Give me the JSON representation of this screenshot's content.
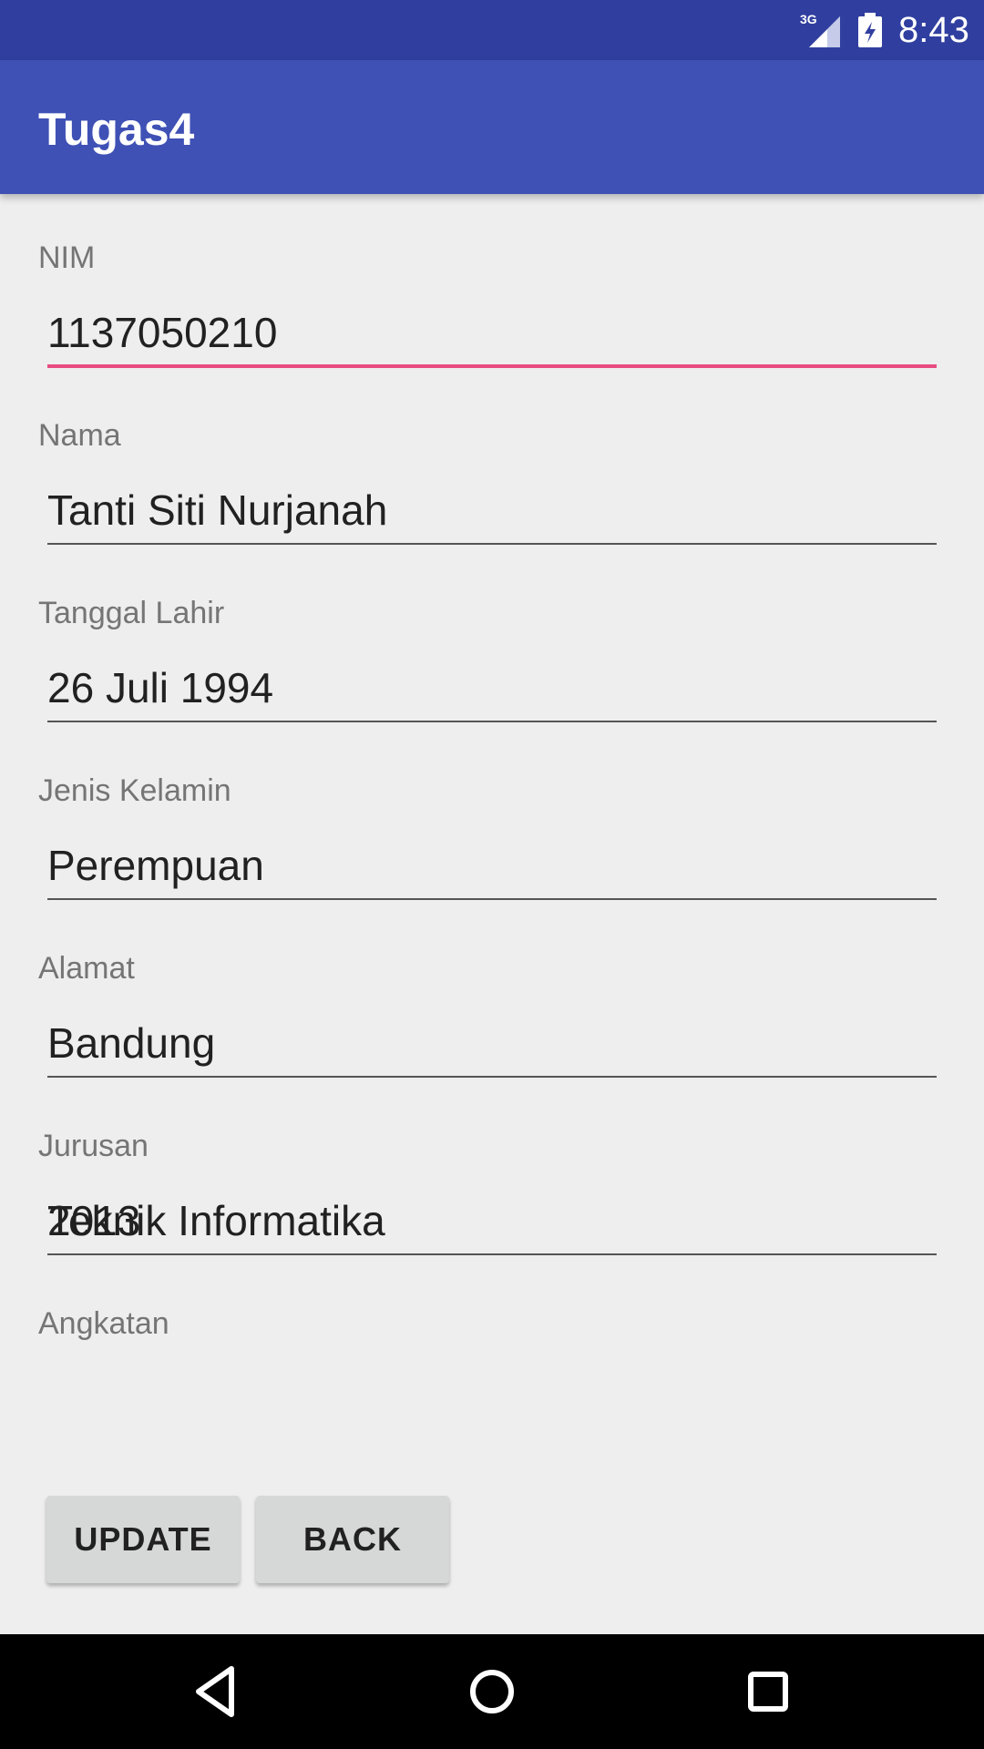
{
  "status_bar": {
    "network": "3G",
    "time": "8:43",
    "icons": [
      "signal-icon",
      "battery-icon"
    ]
  },
  "app_bar": {
    "title": "Tugas4"
  },
  "form": {
    "nim": {
      "label": "NIM",
      "value": "1137050210"
    },
    "nama": {
      "label": "Nama",
      "value": "Tanti Siti Nurjanah"
    },
    "tanggal_lahir": {
      "label": "Tanggal Lahir",
      "value": "26 Juli 1994"
    },
    "jenis_kelamin": {
      "label": "Jenis Kelamin",
      "value": "Perempuan"
    },
    "alamat": {
      "label": "Alamat",
      "value": "Bandung"
    },
    "jurusan": {
      "label": "Jurusan",
      "value": "Teknik Informatika"
    },
    "angkatan": {
      "label": "Angkatan",
      "value": "2013"
    }
  },
  "buttons": {
    "update": "UPDATE",
    "back": "BACK"
  },
  "nav_bar": {
    "icons": [
      "back-icon",
      "home-icon",
      "recents-icon"
    ]
  },
  "colors": {
    "status_bar": "#303F9F",
    "app_bar": "#3F51B5",
    "accent_underline": "#E84C80",
    "background": "#EEEEEE"
  }
}
